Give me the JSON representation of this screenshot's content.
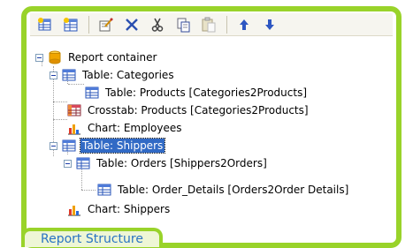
{
  "toolbar": {
    "buttons": [
      {
        "icon": "add-table-icon"
      },
      {
        "icon": "add-subtable-icon"
      },
      {
        "icon": "edit-properties-icon"
      },
      {
        "icon": "delete-icon"
      },
      {
        "icon": "cut-icon"
      },
      {
        "icon": "copy-icon"
      },
      {
        "icon": "paste-icon"
      },
      {
        "icon": "move-up-icon"
      },
      {
        "icon": "move-down-icon"
      }
    ]
  },
  "tree": {
    "items": [
      {
        "label": "Report container",
        "icon": "container-icon"
      },
      {
        "label": "Table: Categories",
        "icon": "table-icon"
      },
      {
        "label": "Table: Products [Categories2Products]",
        "icon": "table-icon"
      },
      {
        "label": "Crosstab: Products [Categories2Products]",
        "icon": "crosstab-icon"
      },
      {
        "label": "Chart: Employees",
        "icon": "chart-icon"
      },
      {
        "label": "Table: Shippers",
        "icon": "table-icon",
        "selected": true
      },
      {
        "label": "Table: Orders [Shippers2Orders]",
        "icon": "table-icon"
      },
      {
        "label": "Table: Order_Details [Orders2Order Details]",
        "icon": "table-icon"
      },
      {
        "label": "Chart: Shippers",
        "icon": "chart-icon"
      }
    ]
  },
  "panel_tab": {
    "label": "Report Structure"
  },
  "colors": {
    "frame": "#99d32a",
    "selection": "#316ac5",
    "tab_text": "#2a74c3"
  }
}
